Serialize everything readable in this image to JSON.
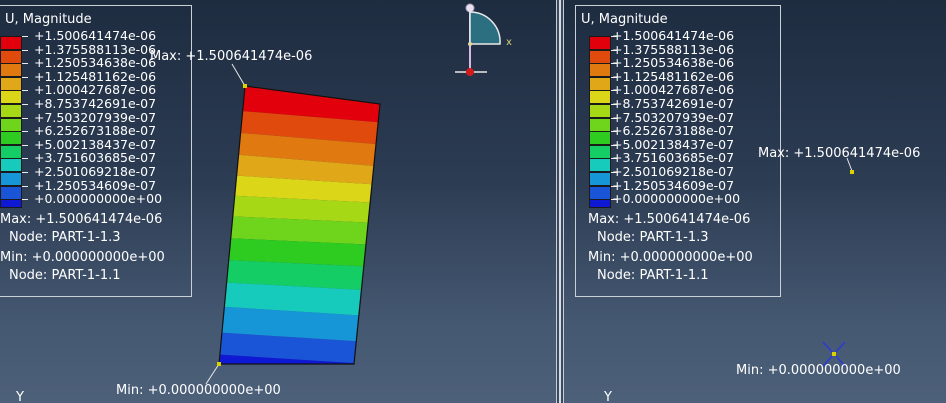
{
  "legend": {
    "title": "U, Magnitude",
    "levels": [
      "+1.500641474e-06",
      "+1.375588113e-06",
      "+1.250534638e-06",
      "+1.125481162e-06",
      "+1.000427687e-06",
      "+8.753742691e-07",
      "+7.503207939e-07",
      "+6.252673188e-07",
      "+5.002138437e-07",
      "+3.751603685e-07",
      "+2.501069218e-07",
      "+1.250534609e-07",
      "+0.000000000e+00"
    ],
    "colors": [
      "#e3000d",
      "#e04a0d",
      "#e07a10",
      "#e0a818",
      "#dbd617",
      "#a7d816",
      "#6fd41c",
      "#2ecb20",
      "#14cd64",
      "#16cbbb",
      "#1696d6",
      "#1a55d8",
      "#0f19d4"
    ],
    "max_text": "Max: +1.500641474e-06",
    "max_node": "Node: PART-1-1.3",
    "min_text": "Min: +0.000000000e+00",
    "min_node": "Node: PART-1-1.1"
  },
  "left_view": {
    "max_annotation": "Max: +1.500641474e-06",
    "min_annotation": "Min: +0.000000000e+00",
    "axis_label": "Y",
    "triad_x_label": "x"
  },
  "right_view": {
    "max_annotation": "Max: +1.500641474e-06",
    "min_annotation": "Min: +0.000000000e+00",
    "axis_label": "Y"
  }
}
